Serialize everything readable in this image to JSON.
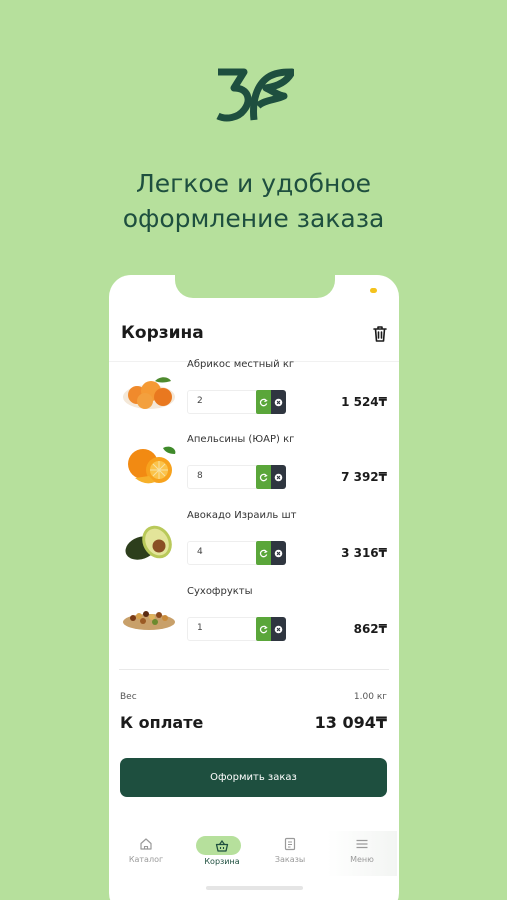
{
  "colors": {
    "background": "#b6e09c",
    "brand_dark": "#1e4f3f",
    "accent_green": "#5aa63a",
    "clear_dark": "#2f3640"
  },
  "promo": {
    "line1": "Легкое и удобное",
    "line2": "оформление заказа"
  },
  "cart": {
    "title": "Корзина",
    "items": [
      {
        "name": "Абрикос местный кг",
        "qty": "2",
        "price": "1 524₸",
        "image": "apricot-image"
      },
      {
        "name": "Апельсины (ЮАР) кг",
        "qty": "8",
        "price": "7 392₸",
        "image": "orange-image"
      },
      {
        "name": "Авокадо Израиль шт",
        "qty": "4",
        "price": "3 316₸",
        "image": "avocado-image"
      },
      {
        "name": "Сухофрукты",
        "qty": "1",
        "price": "862₸",
        "image": "dried-fruits-image"
      }
    ],
    "weight_label": "Вес",
    "weight_value": "1.00 кг",
    "pay_label": "К оплате",
    "pay_value": "13 094₸",
    "checkout_label": "Оформить заказ"
  },
  "tabs": [
    {
      "label": "Каталог",
      "icon": "home-icon"
    },
    {
      "label": "Корзина",
      "icon": "basket-icon",
      "active": true
    },
    {
      "label": "Заказы",
      "icon": "orders-icon"
    },
    {
      "label": "Меню",
      "icon": "menu-icon"
    }
  ]
}
